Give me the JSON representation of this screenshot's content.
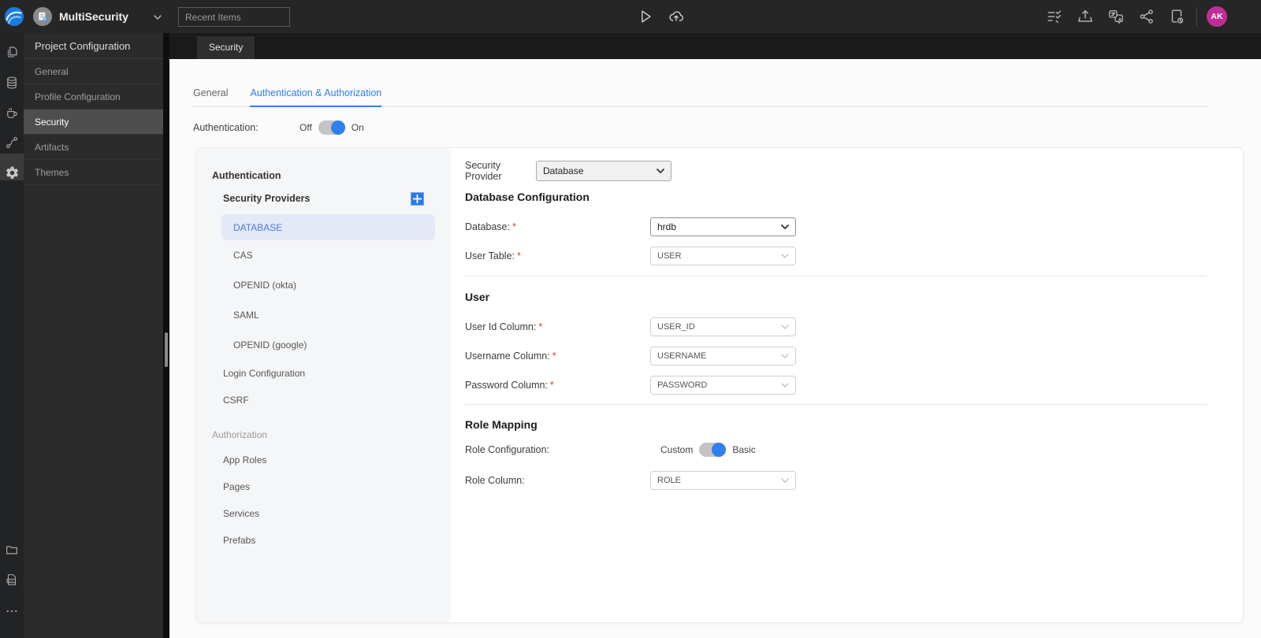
{
  "topbar": {
    "project_name": "MultiSecurity",
    "recent_items_placeholder": "Recent Items",
    "avatar_initials": "AK"
  },
  "sidebar": {
    "title": "Project Configuration",
    "items": [
      {
        "label": "General",
        "active": false
      },
      {
        "label": "Profile Configuration",
        "active": false
      },
      {
        "label": "Security",
        "active": true
      },
      {
        "label": "Artifacts",
        "active": false
      },
      {
        "label": "Themes",
        "active": false
      }
    ]
  },
  "tabstrip": {
    "active_tab": "Security"
  },
  "content": {
    "tabs": [
      {
        "label": "General",
        "active": false
      },
      {
        "label": "Authentication & Authorization",
        "active": true
      }
    ],
    "authentication_row": {
      "label": "Authentication:",
      "off": "Off",
      "on": "On",
      "state": "on"
    },
    "nav_panel": {
      "authentication_header": "Authentication",
      "security_providers_label": "Security Providers",
      "providers": [
        {
          "label": "DATABASE",
          "active": true
        },
        {
          "label": "CAS",
          "active": false
        },
        {
          "label": "OPENID (okta)",
          "active": false
        },
        {
          "label": "SAML",
          "active": false
        },
        {
          "label": "OPENID (google)",
          "active": false
        }
      ],
      "items": [
        {
          "label": "Login Configuration"
        },
        {
          "label": "CSRF"
        }
      ],
      "authorization_header": "Authorization",
      "authorization_items": [
        {
          "label": "App Roles"
        },
        {
          "label": "Pages"
        },
        {
          "label": "Services"
        },
        {
          "label": "Prefabs"
        }
      ]
    },
    "form": {
      "required_marker": "*",
      "security_provider_label": "Security Provider",
      "security_provider_value": "Database",
      "db_config_heading": "Database Configuration",
      "database_label": "Database:",
      "database_value": "hrdb",
      "user_table_label": "User Table:",
      "user_table_value": "USER",
      "user_heading": "User",
      "user_id_label": "User Id Column:",
      "user_id_value": "USER_ID",
      "username_label": "Username Column:",
      "username_value": "USERNAME",
      "password_label": "Password Column:",
      "password_value": "PASSWORD",
      "role_heading": "Role Mapping",
      "role_config_label": "Role Configuration:",
      "role_custom_label": "Custom",
      "role_basic_label": "Basic",
      "role_state": "basic",
      "role_column_label": "Role Column:",
      "role_column_value": "ROLE"
    }
  },
  "colors": {
    "accent_blue": "#2f80ed",
    "avatar_magenta": "#c02d96",
    "selected_provider_bg": "#e3e9f6",
    "selected_provider_text": "#4a79e6",
    "topbar_bg": "#262626",
    "sidebar_bg": "#2b2b2b"
  },
  "icons": {
    "topbar": [
      "wavemaker-logo",
      "project-badge",
      "chevron-down",
      "play",
      "cloud-upload",
      "checklist",
      "export",
      "translate",
      "share",
      "file-sync"
    ],
    "rail": [
      "pages",
      "database",
      "java-services",
      "apis",
      "settings",
      "folder",
      "log-file",
      "more"
    ]
  }
}
